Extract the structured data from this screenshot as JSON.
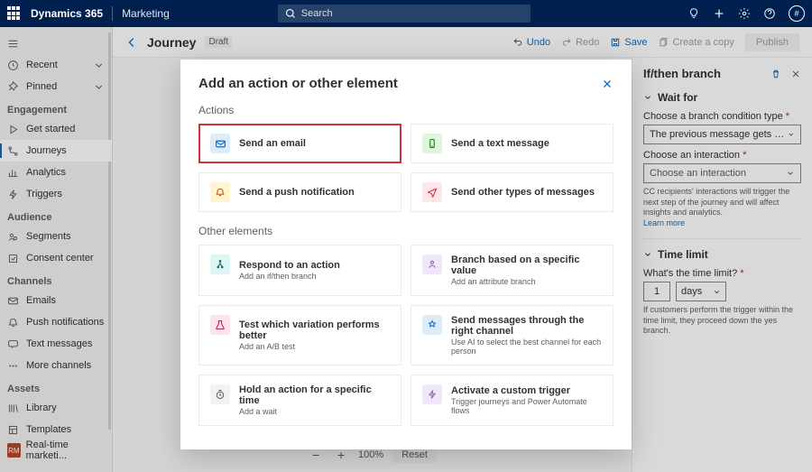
{
  "top": {
    "product": "Dynamics 365",
    "subproduct": "Marketing",
    "search_placeholder": "Search"
  },
  "sidebar": {
    "recent": "Recent",
    "pinned": "Pinned",
    "hdr_engagement": "Engagement",
    "get_started": "Get started",
    "journeys": "Journeys",
    "analytics": "Analytics",
    "triggers": "Triggers",
    "hdr_audience": "Audience",
    "segments": "Segments",
    "consent": "Consent center",
    "hdr_channels": "Channels",
    "emails": "Emails",
    "push": "Push notifications",
    "texts": "Text messages",
    "more_channels": "More channels",
    "hdr_assets": "Assets",
    "library": "Library",
    "templates": "Templates",
    "account_abbrev": "RM",
    "account_label": "Real-time marketi..."
  },
  "cmd": {
    "title": "Journey",
    "draft": "Draft",
    "undo": "Undo",
    "redo": "Redo",
    "save": "Save",
    "copy": "Create a copy",
    "publish": "Publish"
  },
  "zoom": {
    "pct": "100%",
    "reset": "Reset"
  },
  "right": {
    "title": "If/then branch",
    "waitfor": "Wait for",
    "cond_label": "Choose a branch condition type",
    "cond_value": "The previous message gets an interacti…",
    "inter_label": "Choose an interaction",
    "inter_placeholder": "Choose an interaction",
    "help": "CC recipients' interactions will trigger the next step of the journey and will affect insights and analytics.",
    "learn": "Learn more",
    "timelimit_hdr": "Time limit",
    "timelimit_label": "What's the time limit?",
    "time_num": "1",
    "time_unit": "days",
    "time_help": "If customers perform the trigger within the time limit, they proceed down the yes branch."
  },
  "modal": {
    "title": "Add an action or other element",
    "sect_actions": "Actions",
    "send_email": "Send an email",
    "send_text": "Send a text message",
    "send_push": "Send a push notification",
    "send_other": "Send other types of messages",
    "sect_other": "Other elements",
    "respond_t": "Respond to an action",
    "respond_s": "Add an if/then branch",
    "branch_t": "Branch based on a specific value",
    "branch_s": "Add an attribute branch",
    "test_t": "Test which variation performs better",
    "test_s": "Add an A/B test",
    "channel_t": "Send messages through the right channel",
    "channel_s": "Use AI to select the best channel for each person",
    "hold_t": "Hold an action for a specific time",
    "hold_s": "Add a wait",
    "trigger_t": "Activate a custom trigger",
    "trigger_s": "Trigger journeys and Power Automate flows"
  }
}
